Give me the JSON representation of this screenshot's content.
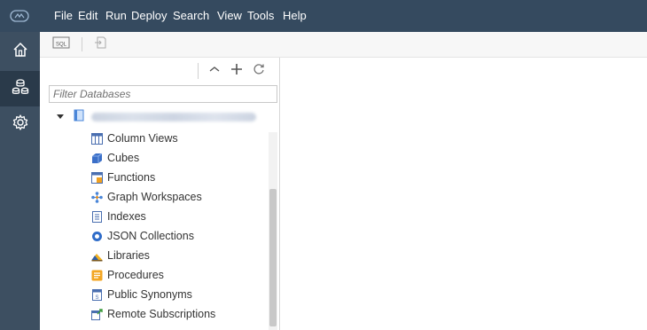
{
  "menubar": {
    "items": [
      "File",
      "Edit",
      "Run",
      "Deploy",
      "Search",
      "View",
      "Tools",
      "Help"
    ]
  },
  "sidebar": {
    "items": [
      {
        "icon": "home-icon"
      },
      {
        "icon": "database-explorer-icon",
        "active": true
      },
      {
        "icon": "settings-icon"
      }
    ]
  },
  "toolbar": {
    "buttons": [
      {
        "icon": "sql-console-icon",
        "text": "SQL"
      },
      {
        "icon": "open-sql-console-icon"
      }
    ]
  },
  "panel": {
    "tools": [
      "collapse-icon",
      "add-icon",
      "refresh-icon"
    ],
    "filter_placeholder": "Filter Databases",
    "tree": [
      {
        "label": "Column Views",
        "icon": "column-views-icon"
      },
      {
        "label": "Cubes",
        "icon": "cubes-icon"
      },
      {
        "label": "Functions",
        "icon": "functions-icon"
      },
      {
        "label": "Graph Workspaces",
        "icon": "graph-workspaces-icon"
      },
      {
        "label": "Indexes",
        "icon": "indexes-icon"
      },
      {
        "label": "JSON Collections",
        "icon": "json-collections-icon"
      },
      {
        "label": "Libraries",
        "icon": "libraries-icon"
      },
      {
        "label": "Procedures",
        "icon": "procedures-icon"
      },
      {
        "label": "Public Synonyms",
        "icon": "public-synonyms-icon"
      },
      {
        "label": "Remote Subscriptions",
        "icon": "remote-subscriptions-icon"
      }
    ]
  }
}
